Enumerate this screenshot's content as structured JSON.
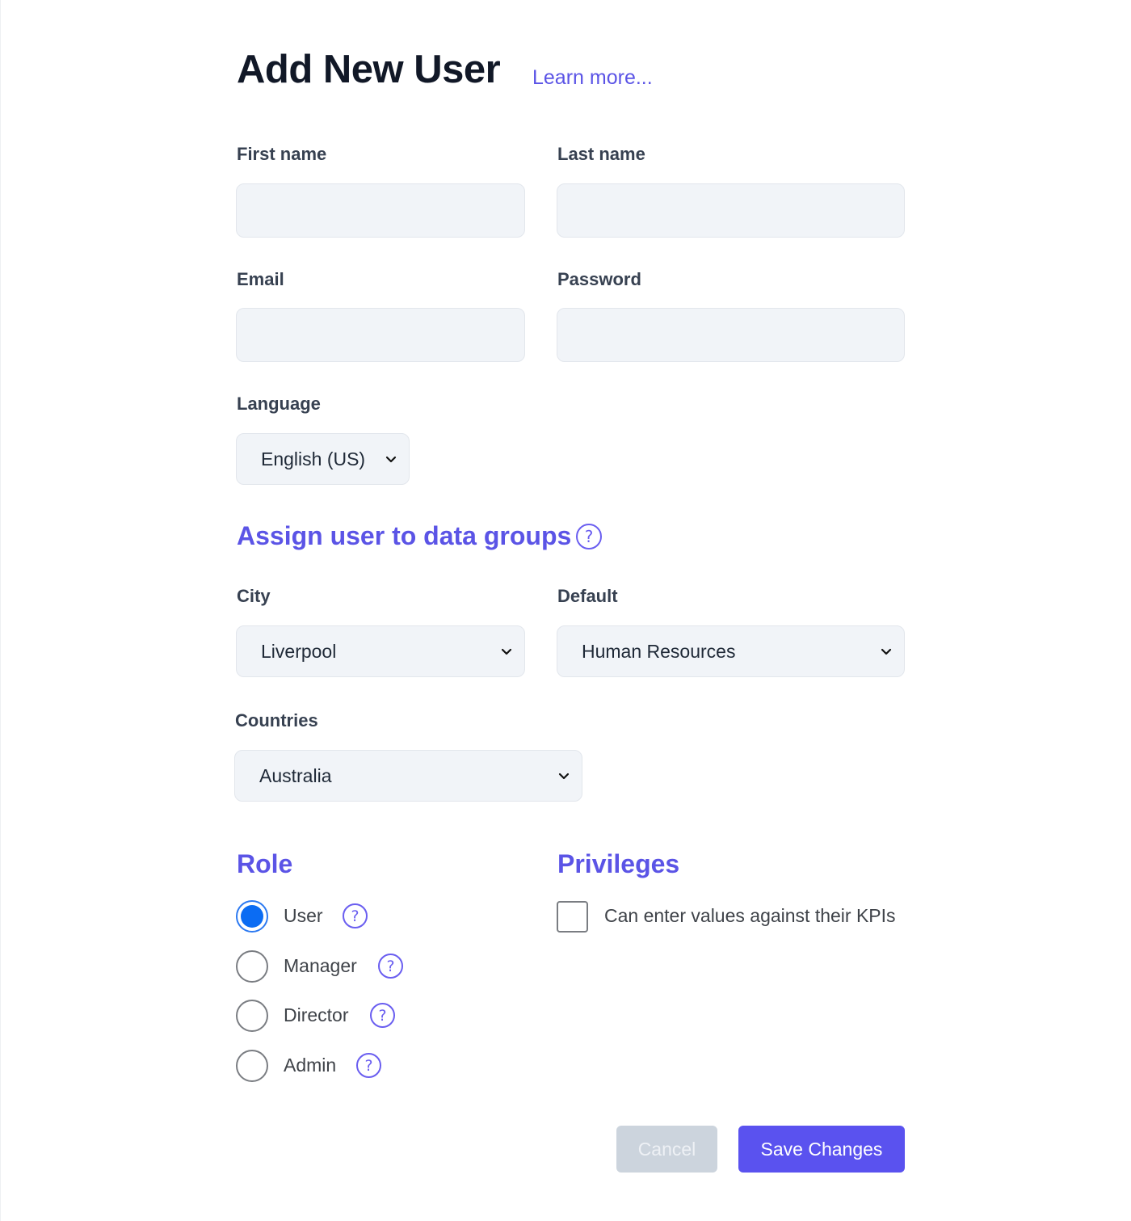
{
  "header": {
    "title": "Add New User",
    "learn_more": "Learn more..."
  },
  "fields": {
    "first_name": {
      "label": "First name",
      "value": "",
      "placeholder": ""
    },
    "last_name": {
      "label": "Last name",
      "value": "",
      "placeholder": ""
    },
    "email": {
      "label": "Email",
      "value": "",
      "placeholder": ""
    },
    "password": {
      "label": "Password",
      "value": "",
      "placeholder": ""
    },
    "language": {
      "label": "Language",
      "selected": "English (US)"
    }
  },
  "data_groups": {
    "heading": "Assign user to data groups",
    "help_icon": "question-circle-icon",
    "city": {
      "label": "City",
      "selected": "Liverpool"
    },
    "default": {
      "label": "Default",
      "selected": "Human Resources"
    },
    "countries": {
      "label": "Countries",
      "selected": "Australia"
    }
  },
  "role": {
    "heading": "Role",
    "options": [
      {
        "label": "User",
        "checked": true
      },
      {
        "label": "Manager",
        "checked": false
      },
      {
        "label": "Director",
        "checked": false
      },
      {
        "label": "Admin",
        "checked": false
      }
    ]
  },
  "privileges": {
    "heading": "Privileges",
    "items": [
      {
        "label": "Can enter values against their KPIs",
        "checked": false
      }
    ]
  },
  "actions": {
    "cancel": "Cancel",
    "save": "Save Changes"
  },
  "icons": {
    "help": "?",
    "chevron": "chevron-down-icon"
  },
  "colors": {
    "accent": "#5b54e6",
    "primary_button": "#5a52ef",
    "disabled_button": "#ccd4dd",
    "radio_selected": "#0b6cf3",
    "input_bg": "#f1f4f8"
  }
}
